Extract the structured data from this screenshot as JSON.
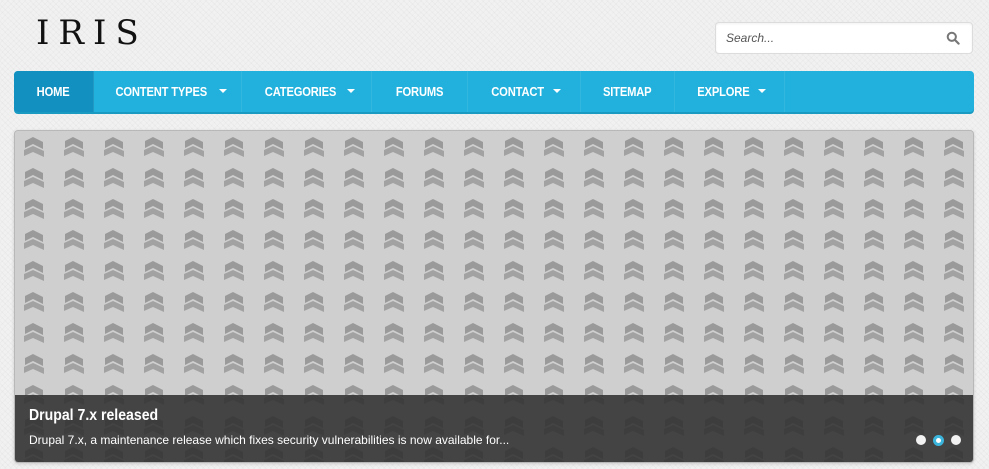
{
  "site": {
    "logo": "IRIS"
  },
  "search": {
    "placeholder": "Search...",
    "icon": "search-icon"
  },
  "nav": {
    "active_color": "#1290c0",
    "bar_color": "#22b1dd",
    "items": [
      {
        "label": "HOME",
        "dropdown": false,
        "active": true
      },
      {
        "label": "CONTENT TYPES",
        "dropdown": true,
        "active": false
      },
      {
        "label": "CATEGORIES",
        "dropdown": true,
        "active": false
      },
      {
        "label": "FORUMS",
        "dropdown": false,
        "active": false
      },
      {
        "label": "CONTACT",
        "dropdown": true,
        "active": false
      },
      {
        "label": "SITEMAP",
        "dropdown": false,
        "active": false
      },
      {
        "label": "EXPLORE",
        "dropdown": true,
        "active": false
      }
    ]
  },
  "slider": {
    "title": "Drupal 7.x released",
    "text": "Drupal 7.x, a maintenance release which fixes security vulnerabilities is now available for...",
    "slide_count": 3,
    "active_slide": 2,
    "dot_active_color": "#3bb5dc"
  }
}
